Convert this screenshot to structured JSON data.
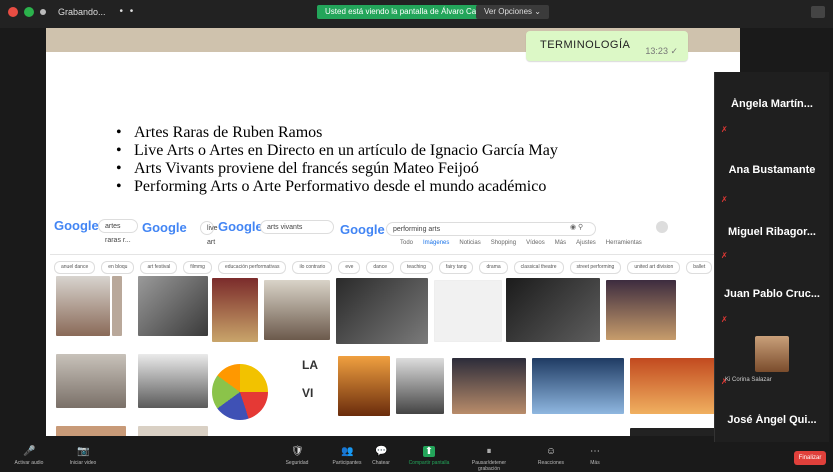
{
  "window": {
    "title": "Grabando...",
    "dots": "• •"
  },
  "share_banner": "Usted está viendo la pantalla de Álvaro Cabrallo",
  "view_options": "Ver Opciones ⌄",
  "chat": {
    "text": "TERMINOLOGÍA",
    "time": "13:23 ✓"
  },
  "slide": {
    "bullets": [
      "Artes Raras de Ruben Ramos",
      "Live Arts o Artes en Directo en un artículo de Ignacio García May",
      "Arts Vivants proviene del francés según Mateo Feijoó",
      "Performing Arts o Arte Performativo desde el mundo académico"
    ]
  },
  "google": {
    "logos": [
      "Google",
      "Google",
      "Google",
      "Google"
    ],
    "queries": [
      "artes raras r...",
      "live art",
      "arts vivants",
      "performing arts"
    ],
    "tabs": [
      "Todo",
      "Imágenes",
      "Noticias",
      "Shopping",
      "Vídeos",
      "Más",
      "Ajustes",
      "Herramientas"
    ],
    "chips": [
      "anuel dance",
      "en bloqu",
      "art festival",
      "filmmg",
      "educación performativas",
      "ilo contrario",
      "eve",
      "dance",
      "teaching",
      "fairy tang",
      "drama",
      "classical theatre",
      "street performing",
      "united art division",
      "ballet"
    ]
  },
  "participants": [
    {
      "name": "Ángela Martín..."
    },
    {
      "name": "Ana Bustamante"
    },
    {
      "name": "Miguel Ribagor..."
    },
    {
      "name": "Juan Pablo Cruc..."
    },
    {
      "name": "Ki Corina Salazar"
    },
    {
      "name": "José Ángel Qui..."
    }
  ],
  "toolbar": {
    "left": [
      {
        "label": "Activar audio",
        "icon": "🎤"
      },
      {
        "label": "Iniciar video",
        "icon": "📷"
      }
    ],
    "center": [
      {
        "label": "Seguridad",
        "icon": "🛡"
      },
      {
        "label": "Participantes",
        "icon": "👥"
      },
      {
        "label": "Chatear",
        "icon": "💬"
      },
      {
        "label": "Compartir pantalla",
        "icon": "⬆"
      },
      {
        "label": "Pausar/detener grabación",
        "icon": "⏸"
      },
      {
        "label": "Reacciones",
        "icon": "☺"
      },
      {
        "label": "Más",
        "icon": "⋯"
      }
    ],
    "end_label": "Finalizar"
  },
  "colors": {
    "accent_green": "#23a55a",
    "end_red": "#e0403b",
    "mic_muted": "#e53935"
  }
}
